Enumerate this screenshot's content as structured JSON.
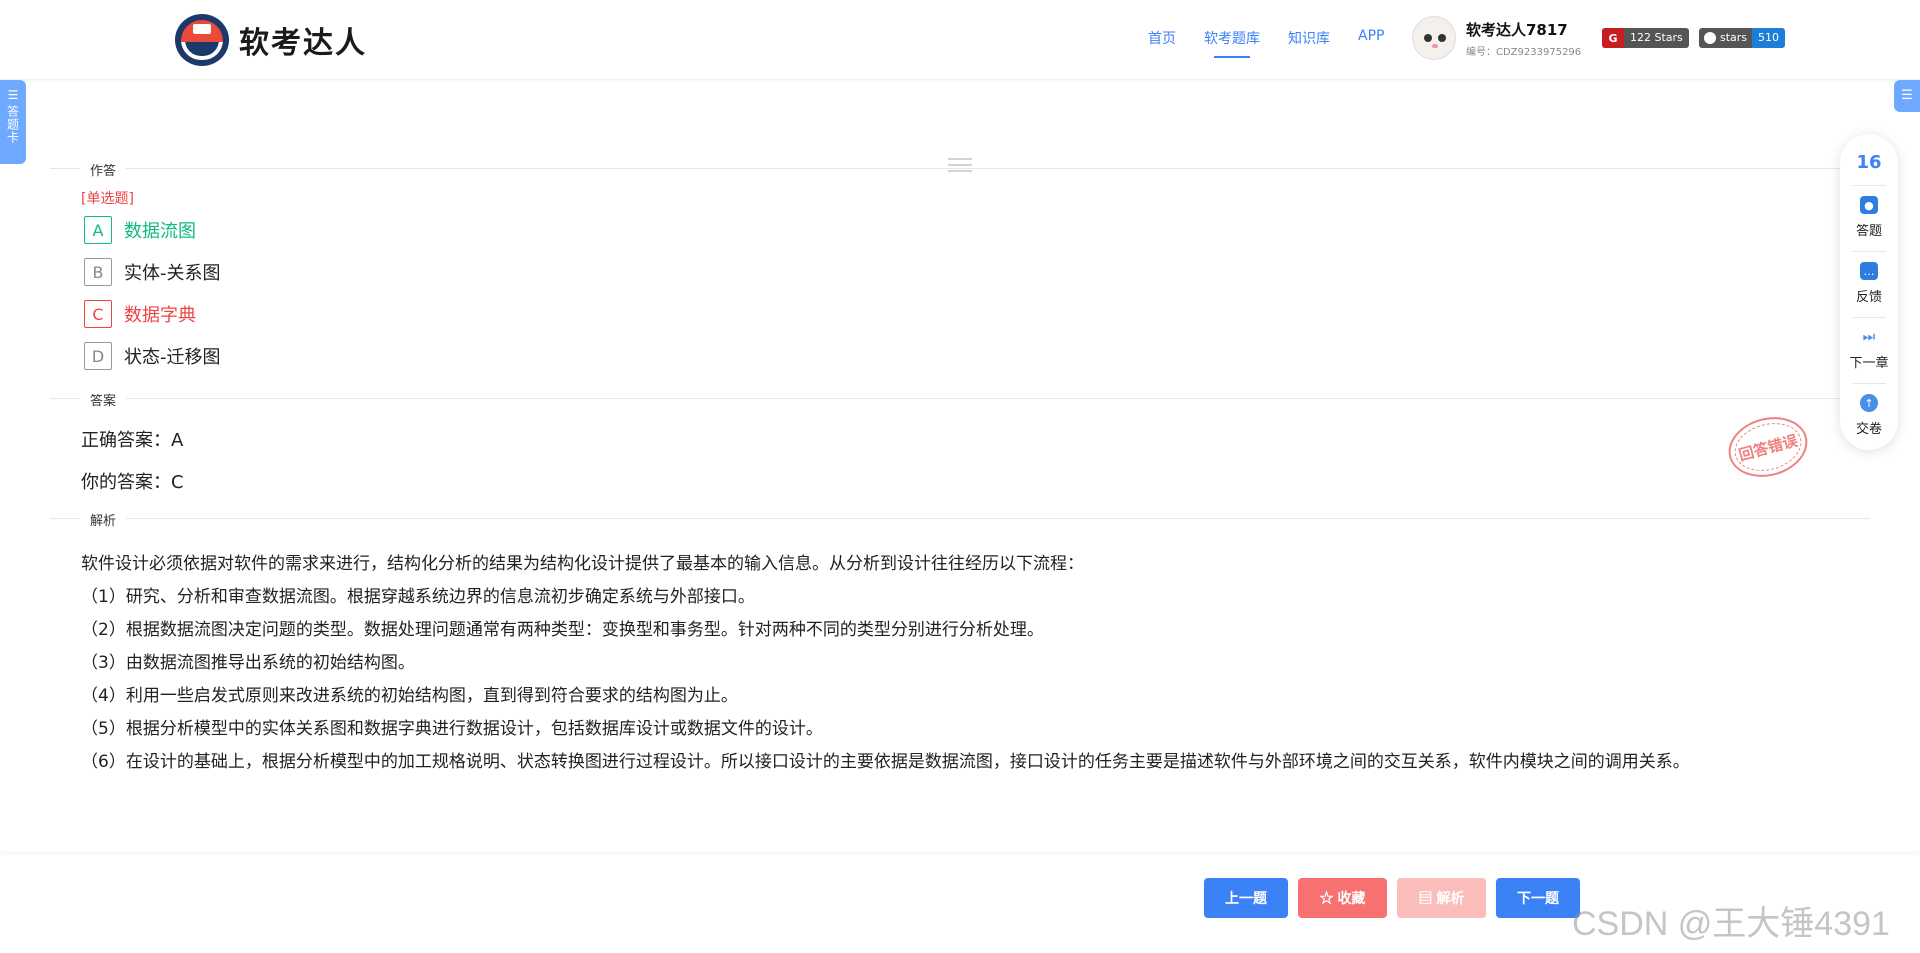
{
  "header": {
    "logo_text": "软考达人",
    "nav": [
      {
        "label": "首页"
      },
      {
        "label": "软考题库"
      },
      {
        "label": "知识库"
      },
      {
        "label": "APP"
      }
    ],
    "user": {
      "name": "软考达人7817",
      "id": "编号：CDZ9233975296"
    },
    "badges": {
      "gitee_stars": "122 Stars",
      "github_label": "stars",
      "github_count": "510"
    }
  },
  "side": {
    "left_tab_label": "答题卡"
  },
  "sections": {
    "answer_area": "作答",
    "answer": "答案",
    "analysis": "解析"
  },
  "question": {
    "type": "[单选题]",
    "options": [
      {
        "key": "A",
        "text": "数据流图",
        "state": "correct"
      },
      {
        "key": "B",
        "text": "实体-关系图",
        "state": "normal"
      },
      {
        "key": "C",
        "text": "数据字典",
        "state": "wrong"
      },
      {
        "key": "D",
        "text": "状态-迁移图",
        "state": "normal"
      }
    ]
  },
  "answer": {
    "correct": "正确答案：A",
    "yours": "你的答案：C",
    "stamp": "回答错误"
  },
  "analysis": {
    "paragraphs": [
      "软件设计必须依据对软件的需求来进行，结构化分析的结果为结构化设计提供了最基本的输入信息。从分析到设计往往经历以下流程：",
      "（1）研究、分析和审查数据流图。根据穿越系统边界的信息流初步确定系统与外部接口。",
      "（2）根据数据流图决定问题的类型。数据处理问题通常有两种类型：变换型和事务型。针对两种不同的类型分别进行分析处理。",
      "（3）由数据流图推导出系统的初始结构图。",
      "（4）利用一些启发式原则来改进系统的初始结构图，直到得到符合要求的结构图为止。",
      "（5）根据分析模型中的实体关系图和数据字典进行数据设计，包括数据库设计或数据文件的设计。",
      "（6）在设计的基础上，根据分析模型中的加工规格说明、状态转换图进行过程设计。所以接口设计的主要依据是数据流图，接口设计的任务主要是描述软件与外部环境之间的交互关系，软件内模块之间的调用关系。"
    ]
  },
  "floatbar": {
    "count": "16",
    "items": [
      {
        "label": "答题",
        "icon": "answer-icon"
      },
      {
        "label": "反馈",
        "icon": "feedback-icon"
      },
      {
        "label": "下一章",
        "icon": "next-chapter-icon"
      },
      {
        "label": "交卷",
        "icon": "submit-icon"
      }
    ]
  },
  "footer": {
    "prev": "上一题",
    "favorite": "☆ 收藏",
    "analysis": "▤ 解析",
    "next": "下一题"
  },
  "watermark": "CSDN @王大锤4391",
  "colors": {
    "primary": "#3b82f6",
    "correct": "#10b981",
    "wrong": "#ef4444"
  }
}
